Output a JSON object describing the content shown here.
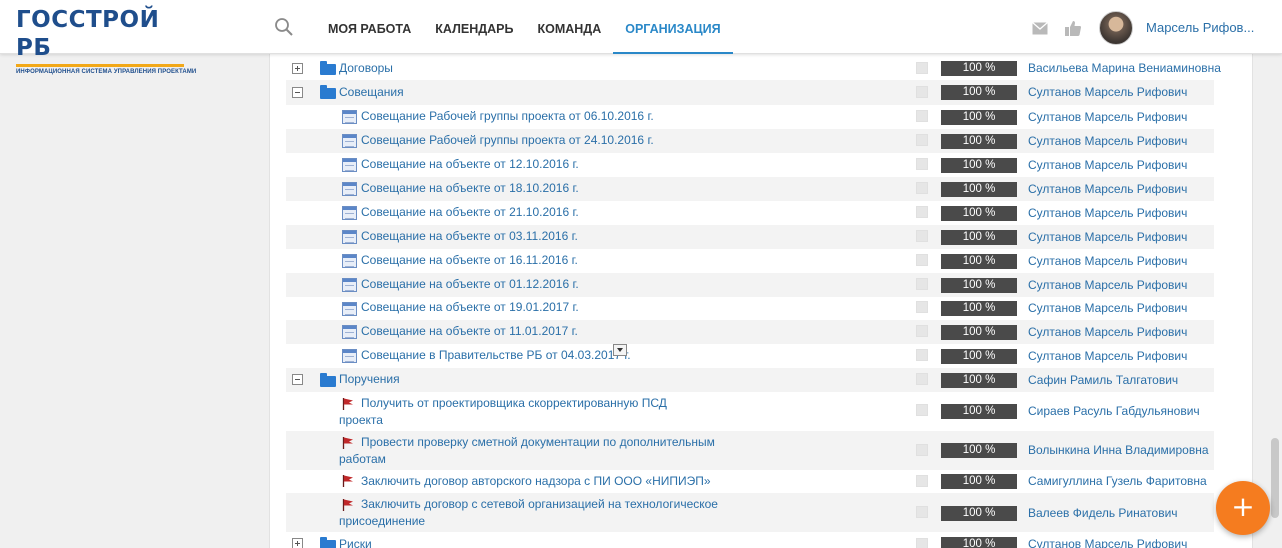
{
  "logo": {
    "title": "ГОССТРОЙ РБ",
    "subtitle": "ИНФОРМАЦИОННАЯ СИСТЕМА УПРАВЛЕНИЯ ПРОЕКТАМИ"
  },
  "nav": {
    "my_work": "МОЯ РАБОТА",
    "calendar": "КАЛЕНДАРЬ",
    "team": "КОМАНДА",
    "organization": "ОРГАНИЗАЦИЯ"
  },
  "user": {
    "name": "Марсель Рифов..."
  },
  "icons": {
    "search": "search-icon",
    "mail": "mail-icon",
    "like": "thumbs-up-icon",
    "fab": "plus-icon"
  },
  "colors": {
    "brand": "#1f4e8c",
    "accent": "#2a88c8",
    "link": "#2a6fa8",
    "fab": "#f57c1f",
    "progress": "#4a4a4a",
    "flag": "#c0282a"
  },
  "fab": {
    "label": "+"
  },
  "rows": [
    {
      "name": "Договоры",
      "percent": "100 %",
      "owner": "Васильева Марина Вениаминовна"
    },
    {
      "name": "Совещания",
      "percent": "100 %",
      "owner": "Султанов Марсель Рифович"
    },
    {
      "name": "Совещание Рабочей группы проекта от 06.10.2016 г.",
      "percent": "100 %",
      "owner": "Султанов Марсель Рифович"
    },
    {
      "name": "Совещание Рабочей группы проекта от 24.10.2016 г.",
      "percent": "100 %",
      "owner": "Султанов Марсель Рифович"
    },
    {
      "name": "Совещание на объекте от 12.10.2016 г.",
      "percent": "100 %",
      "owner": "Султанов Марсель Рифович"
    },
    {
      "name": "Совещание на объекте от 18.10.2016 г.",
      "percent": "100 %",
      "owner": "Султанов Марсель Рифович"
    },
    {
      "name": "Совещание на объекте от 21.10.2016 г.",
      "percent": "100 %",
      "owner": "Султанов Марсель Рифович"
    },
    {
      "name": "Совещание на объекте от 03.11.2016 г.",
      "percent": "100 %",
      "owner": "Султанов Марсель Рифович"
    },
    {
      "name": "Совещание на объекте от 16.11.2016 г.",
      "percent": "100 %",
      "owner": "Султанов Марсель Рифович"
    },
    {
      "name": "Совещание на объекте от 01.12.2016 г.",
      "percent": "100 %",
      "owner": "Султанов Марсель Рифович"
    },
    {
      "name": "Совещание на объекте от 19.01.2017 г.",
      "percent": "100 %",
      "owner": "Султанов Марсель Рифович"
    },
    {
      "name": "Совещание на объекте от 11.01.2017 г.",
      "percent": "100 %",
      "owner": "Султанов Марсель Рифович"
    },
    {
      "name": "Совещание в Правительстве РБ от 04.03.2017 г.",
      "percent": "100 %",
      "owner": "Султанов Марсель Рифович"
    },
    {
      "name": "Поручения",
      "percent": "100 %",
      "owner": "Сафин Рамиль Талгатович"
    },
    {
      "name_line1": "Получить от проектировщика скорректированную ПСД",
      "name_line2": "проекта",
      "percent": "100 %",
      "owner": "Сираев Расуль Габдульянович"
    },
    {
      "name_line1": "Провести проверку сметной документации по дополнительным",
      "name_line2": "работам",
      "percent": "100 %",
      "owner": "Волынкина Инна Владимировна"
    },
    {
      "name": "Заключить договор авторского надзора с ПИ ООО «НИПИЭП»",
      "percent": "100 %",
      "owner": "Самигуллина Гузель Фаритовна"
    },
    {
      "name_line1": "Заключить договор с сетевой организацией на технологическое",
      "name_line2": "присоединение",
      "percent": "100 %",
      "owner": "Валеев Фидель Ринатович"
    },
    {
      "name": "Риски",
      "percent": "100 %",
      "owner": "Султанов Марсель Рифович"
    }
  ]
}
